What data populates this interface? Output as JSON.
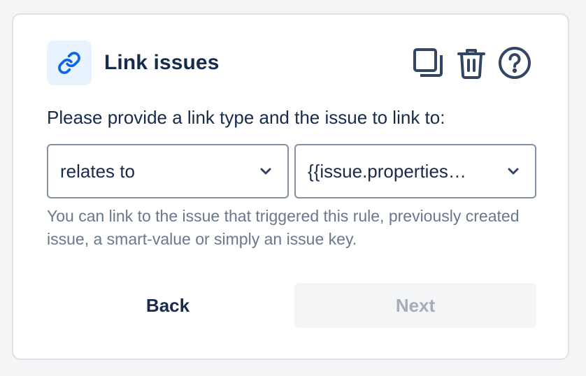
{
  "header": {
    "title": "Link issues",
    "icon": "link-icon",
    "actions": [
      "copy-icon",
      "trash-icon",
      "help-icon"
    ]
  },
  "prompt": "Please provide a link type and the issue to link to:",
  "fields": {
    "link_type": {
      "value": "relates to"
    },
    "issue": {
      "value": "{{issue.properties…"
    }
  },
  "help_text": "You can link to the issue that triggered this rule, previously created issue, a smart-value or simply an issue key.",
  "buttons": {
    "back_label": "Back",
    "next_label": "Next",
    "next_disabled": true
  },
  "colors": {
    "accent": "#0c66e4",
    "text": "#172b4d",
    "muted": "#6b778c",
    "icon_bg": "#e9f2ff",
    "disabled_text": "#a5adba"
  }
}
